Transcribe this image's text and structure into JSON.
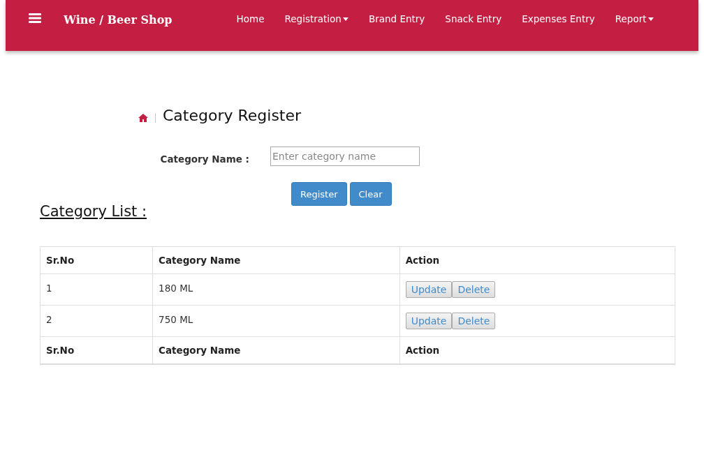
{
  "navbar": {
    "brand": "Wine / Beer Shop",
    "items": [
      {
        "label": "Home",
        "dropdown": false
      },
      {
        "label": "Registration",
        "dropdown": true
      },
      {
        "label": "Brand Entry",
        "dropdown": false
      },
      {
        "label": "Snack Entry",
        "dropdown": false
      },
      {
        "label": "Expenses Entry",
        "dropdown": false
      },
      {
        "label": "Report",
        "dropdown": true
      }
    ]
  },
  "page_title": "Category Register",
  "form": {
    "label": "Category Name :",
    "placeholder": "Enter category name",
    "buttons": [
      "Register",
      "Clear"
    ]
  },
  "list_title": "Category List :",
  "table": {
    "columns": [
      "Sr.No",
      "Category Name",
      "Action"
    ],
    "rows": [
      {
        "cells": [
          "1",
          "180 ML"
        ],
        "actions": [
          "Update",
          "Delete"
        ]
      },
      {
        "cells": [
          "2",
          "750 ML"
        ],
        "actions": [
          "Update",
          "Delete"
        ]
      }
    ],
    "footer": [
      "Sr.No",
      "Category Name",
      "Action"
    ]
  }
}
